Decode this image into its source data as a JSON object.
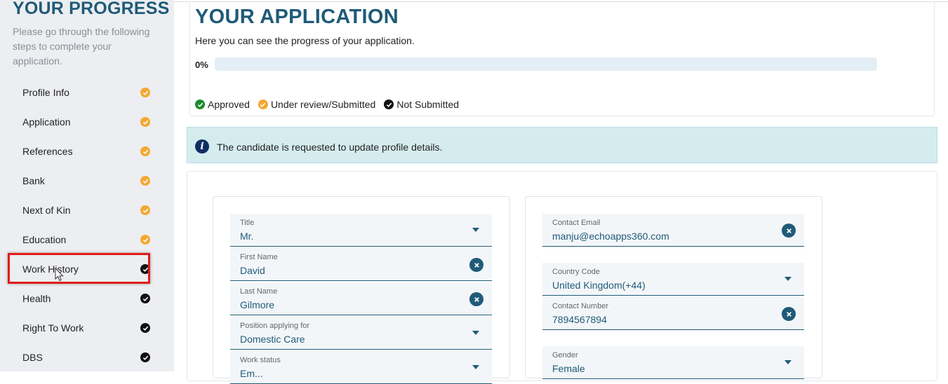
{
  "sidebar": {
    "title": "YOUR PROGRESS",
    "description": "Please go through the following steps to complete your application.",
    "steps": [
      {
        "label": "Profile Info",
        "status": "under-review",
        "color": "#f3a833"
      },
      {
        "label": "Application",
        "status": "under-review",
        "color": "#f3a833"
      },
      {
        "label": "References",
        "status": "under-review",
        "color": "#f3a833"
      },
      {
        "label": "Bank",
        "status": "under-review",
        "color": "#f3a833"
      },
      {
        "label": "Next of Kin",
        "status": "under-review",
        "color": "#f3a833"
      },
      {
        "label": "Education",
        "status": "under-review",
        "color": "#f3a833"
      },
      {
        "label": "Work History",
        "status": "not-submitted",
        "color": "#111111"
      },
      {
        "label": "Health",
        "status": "not-submitted",
        "color": "#111111"
      },
      {
        "label": "Right To Work",
        "status": "not-submitted",
        "color": "#111111"
      },
      {
        "label": "DBS",
        "status": "not-submitted",
        "color": "#111111"
      }
    ]
  },
  "application": {
    "title": "YOUR APPLICATION",
    "subtitle": "Here you can see the progress of your application.",
    "progress_label": "0%",
    "progress_fraction": 0
  },
  "legend": {
    "approved": "Approved",
    "under_review": "Under review/Submitted",
    "not_submitted": "Not Submitted"
  },
  "info": {
    "message": "The candidate is requested to update profile details.",
    "icon": "info-icon"
  },
  "form": {
    "title": {
      "label": "Title",
      "value": "Mr."
    },
    "first_name": {
      "label": "First Name",
      "value": "David"
    },
    "last_name": {
      "label": "Last Name",
      "value": "Gilmore"
    },
    "position": {
      "label": "Position applying for",
      "value": "Domestic Care"
    },
    "work_status": {
      "label": "Work status",
      "value": "Em..."
    },
    "contact_email": {
      "label": "Contact Email",
      "value": "manju@echoapps360.com"
    },
    "country_code": {
      "label": "Country Code",
      "value": "United Kingdom(+44)"
    },
    "contact_number": {
      "label": "Contact Number",
      "value": "7894567894"
    },
    "gender": {
      "label": "Gender",
      "value": "Female"
    }
  },
  "colors": {
    "accent": "#1f5b78",
    "approved": "#1e8a2e",
    "under_review": "#f3a833",
    "not_submitted": "#111111",
    "highlight": "#e21b1b"
  }
}
